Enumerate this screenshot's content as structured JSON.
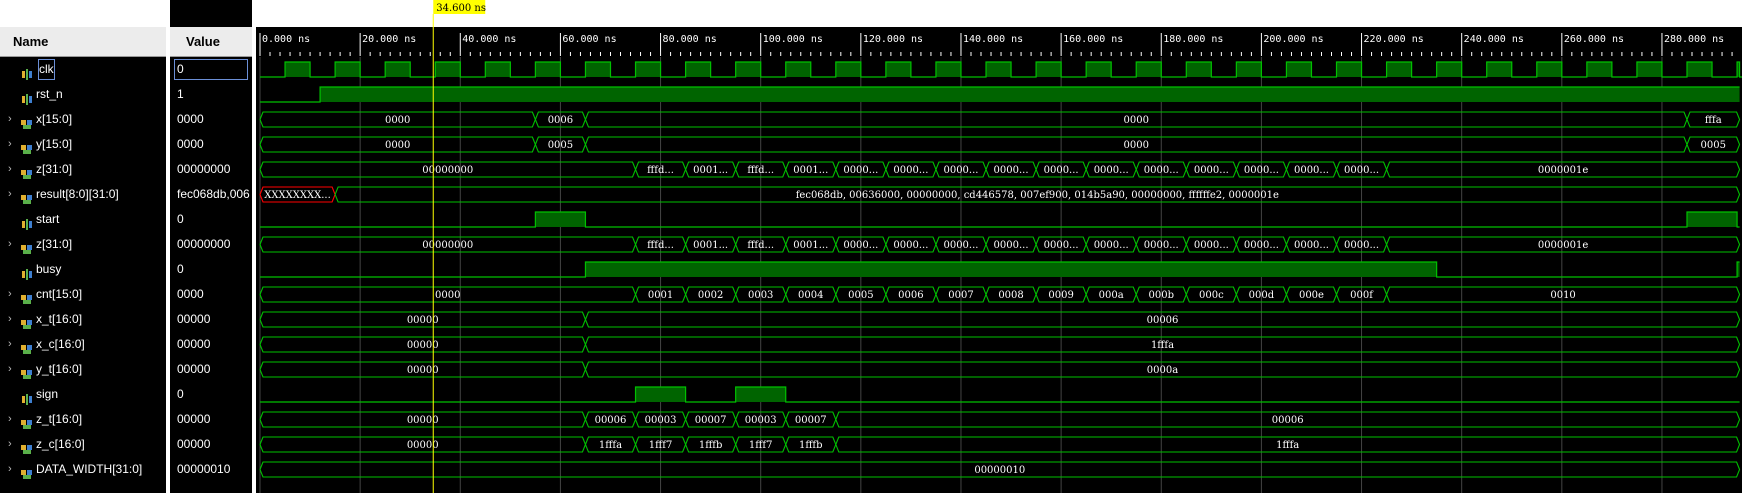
{
  "panels": {
    "name_header": "Name",
    "value_header": "Value"
  },
  "cursor": {
    "label": "34.600 ns",
    "time_ns": 34.6
  },
  "timeline": {
    "ticks": [
      "0.000 ns",
      "20.000 ns",
      "40.000 ns",
      "60.000 ns",
      "80.000 ns",
      "100.000 ns",
      "120.000 ns",
      "140.000 ns",
      "160.000 ns",
      "180.000 ns",
      "200.000 ns",
      "220.000 ns",
      "240.000 ns",
      "260.000 ns",
      "280.000 ns"
    ],
    "end_ns": 295.5
  },
  "colors": {
    "wave": "#00c000",
    "fill": "#006400",
    "cursor": "#ffff00",
    "invalid": "#ff0000",
    "grid": "#444444"
  },
  "signals": [
    {
      "name": "clk",
      "value": "0",
      "kind": "bit",
      "icon": "bit-icon",
      "expandable": false,
      "selected": true,
      "clock": {
        "period_ns": 10,
        "high_start_ns": 5,
        "high_dur_ns": 5
      }
    },
    {
      "name": "rst_n",
      "value": "1",
      "kind": "bit",
      "icon": "bit-icon",
      "expandable": false,
      "changes": [
        [
          0,
          0
        ],
        [
          12,
          1
        ]
      ]
    },
    {
      "name": "x[15:0]",
      "value": "0000",
      "kind": "bus",
      "icon": "bus-icon",
      "expandable": true,
      "segments": [
        [
          0,
          55,
          "0000"
        ],
        [
          55,
          65,
          "0006"
        ],
        [
          65,
          285,
          "0000"
        ],
        [
          285,
          295.5,
          "fffa"
        ]
      ]
    },
    {
      "name": "y[15:0]",
      "value": "0000",
      "kind": "bus",
      "icon": "bus-icon",
      "expandable": true,
      "segments": [
        [
          0,
          55,
          "0000"
        ],
        [
          55,
          65,
          "0005"
        ],
        [
          65,
          285,
          "0000"
        ],
        [
          285,
          295.5,
          "0005"
        ]
      ]
    },
    {
      "name": "z[31:0]",
      "value": "00000000",
      "kind": "bus",
      "icon": "bus-icon",
      "expandable": true,
      "segments": [
        [
          0,
          75,
          "00000000"
        ],
        [
          75,
          85,
          "fffd..."
        ],
        [
          85,
          95,
          "0001..."
        ],
        [
          95,
          105,
          "fffd..."
        ],
        [
          105,
          115,
          "0001..."
        ],
        [
          115,
          125,
          "0000..."
        ],
        [
          125,
          135,
          "0000..."
        ],
        [
          135,
          145,
          "0000..."
        ],
        [
          145,
          155,
          "0000..."
        ],
        [
          155,
          165,
          "0000..."
        ],
        [
          165,
          175,
          "0000..."
        ],
        [
          175,
          185,
          "0000..."
        ],
        [
          185,
          195,
          "0000..."
        ],
        [
          195,
          205,
          "0000..."
        ],
        [
          205,
          215,
          "0000..."
        ],
        [
          215,
          225,
          "0000..."
        ],
        [
          225,
          295.5,
          "0000001e"
        ]
      ]
    },
    {
      "name": "result[8:0][31:0]",
      "value": "fec068db,006",
      "kind": "bus",
      "icon": "bus-icon",
      "expandable": true,
      "segments": [
        [
          0,
          15,
          "XXXXXXXX...",
          "invalid"
        ],
        [
          15,
          295.5,
          "fec068db, 00636000, 00000000, cd446578, 007ef900, 014b5a90, 00000000, ffffffe2, 0000001e"
        ]
      ]
    },
    {
      "name": "start",
      "value": "0",
      "kind": "bit",
      "icon": "bit-icon",
      "expandable": false,
      "changes": [
        [
          0,
          0
        ],
        [
          55,
          1
        ],
        [
          65,
          0
        ],
        [
          285,
          1
        ],
        [
          295,
          0
        ]
      ]
    },
    {
      "name": "z[31:0]",
      "value": "00000000",
      "kind": "bus",
      "icon": "bus-icon",
      "expandable": true,
      "segments": [
        [
          0,
          75,
          "00000000"
        ],
        [
          75,
          85,
          "fffd..."
        ],
        [
          85,
          95,
          "0001..."
        ],
        [
          95,
          105,
          "fffd..."
        ],
        [
          105,
          115,
          "0001..."
        ],
        [
          115,
          125,
          "0000..."
        ],
        [
          125,
          135,
          "0000..."
        ],
        [
          135,
          145,
          "0000..."
        ],
        [
          145,
          155,
          "0000..."
        ],
        [
          155,
          165,
          "0000..."
        ],
        [
          165,
          175,
          "0000..."
        ],
        [
          175,
          185,
          "0000..."
        ],
        [
          185,
          195,
          "0000..."
        ],
        [
          195,
          205,
          "0000..."
        ],
        [
          205,
          215,
          "0000..."
        ],
        [
          215,
          225,
          "0000..."
        ],
        [
          225,
          295.5,
          "0000001e"
        ]
      ]
    },
    {
      "name": "busy",
      "value": "0",
      "kind": "bit",
      "icon": "bit-icon",
      "expandable": false,
      "changes": [
        [
          0,
          0
        ],
        [
          65,
          1
        ],
        [
          235,
          0
        ],
        [
          295,
          1
        ]
      ]
    },
    {
      "name": "cnt[15:0]",
      "value": "0000",
      "kind": "bus",
      "icon": "bus-icon",
      "expandable": true,
      "segments": [
        [
          0,
          75,
          "0000"
        ],
        [
          75,
          85,
          "0001"
        ],
        [
          85,
          95,
          "0002"
        ],
        [
          95,
          105,
          "0003"
        ],
        [
          105,
          115,
          "0004"
        ],
        [
          115,
          125,
          "0005"
        ],
        [
          125,
          135,
          "0006"
        ],
        [
          135,
          145,
          "0007"
        ],
        [
          145,
          155,
          "0008"
        ],
        [
          155,
          165,
          "0009"
        ],
        [
          165,
          175,
          "000a"
        ],
        [
          175,
          185,
          "000b"
        ],
        [
          185,
          195,
          "000c"
        ],
        [
          195,
          205,
          "000d"
        ],
        [
          205,
          215,
          "000e"
        ],
        [
          215,
          225,
          "000f"
        ],
        [
          225,
          295.5,
          "0010"
        ]
      ]
    },
    {
      "name": "x_t[16:0]",
      "value": "00000",
      "kind": "bus",
      "icon": "bus-icon",
      "expandable": true,
      "segments": [
        [
          0,
          65,
          "00000"
        ],
        [
          65,
          295.5,
          "00006"
        ]
      ]
    },
    {
      "name": "x_c[16:0]",
      "value": "00000",
      "kind": "bus",
      "icon": "bus-icon",
      "expandable": true,
      "segments": [
        [
          0,
          65,
          "00000"
        ],
        [
          65,
          295.5,
          "1fffa"
        ]
      ]
    },
    {
      "name": "y_t[16:0]",
      "value": "00000",
      "kind": "bus",
      "icon": "bus-icon",
      "expandable": true,
      "segments": [
        [
          0,
          65,
          "00000"
        ],
        [
          65,
          295.5,
          "0000a"
        ]
      ]
    },
    {
      "name": "sign",
      "value": "0",
      "kind": "bit",
      "icon": "bit-icon",
      "expandable": false,
      "changes": [
        [
          0,
          0
        ],
        [
          75,
          1
        ],
        [
          85,
          0
        ],
        [
          95,
          1
        ],
        [
          105,
          0
        ]
      ]
    },
    {
      "name": "z_t[16:0]",
      "value": "00000",
      "kind": "bus",
      "icon": "bus-icon",
      "expandable": true,
      "segments": [
        [
          0,
          65,
          "00000"
        ],
        [
          65,
          75,
          "00006"
        ],
        [
          75,
          85,
          "00003"
        ],
        [
          85,
          95,
          "00007"
        ],
        [
          95,
          105,
          "00003"
        ],
        [
          105,
          115,
          "00007"
        ],
        [
          115,
          295.5,
          "00006"
        ]
      ]
    },
    {
      "name": "z_c[16:0]",
      "value": "00000",
      "kind": "bus",
      "icon": "bus-icon",
      "expandable": true,
      "segments": [
        [
          0,
          65,
          "00000"
        ],
        [
          65,
          75,
          "1fffa"
        ],
        [
          75,
          85,
          "1fff7"
        ],
        [
          85,
          95,
          "1fffb"
        ],
        [
          95,
          105,
          "1fff7"
        ],
        [
          105,
          115,
          "1fffb"
        ],
        [
          115,
          295.5,
          "1fffa"
        ]
      ]
    },
    {
      "name": "DATA_WIDTH[31:0]",
      "value": "00000010",
      "kind": "bus",
      "icon": "param-icon",
      "expandable": true,
      "segments": [
        [
          0,
          295.5,
          "00000010"
        ]
      ]
    }
  ]
}
